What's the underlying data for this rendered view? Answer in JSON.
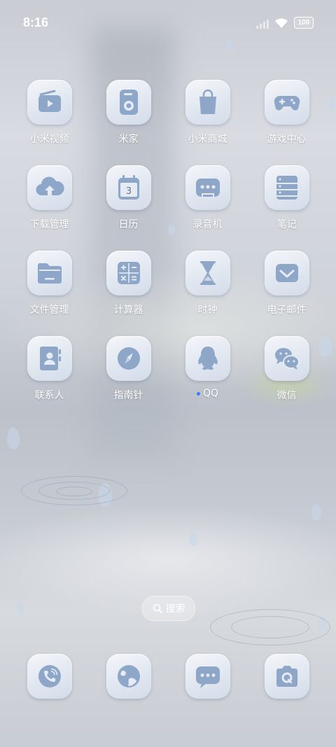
{
  "status_bar": {
    "time": "8:16",
    "battery": "100"
  },
  "apps": [
    [
      {
        "label": "小米视频",
        "icon": "video-icon"
      },
      {
        "label": "米家",
        "icon": "mijia-icon"
      },
      {
        "label": "小米商城",
        "icon": "shopping-bag-icon"
      },
      {
        "label": "游戏中心",
        "icon": "gamepad-icon"
      }
    ],
    [
      {
        "label": "下载管理",
        "icon": "cloud-download-icon"
      },
      {
        "label": "日历",
        "icon": "calendar-icon",
        "day": "3"
      },
      {
        "label": "录音机",
        "icon": "recorder-icon"
      },
      {
        "label": "笔记",
        "icon": "notes-icon"
      }
    ],
    [
      {
        "label": "文件管理",
        "icon": "folder-icon"
      },
      {
        "label": "计算器",
        "icon": "calculator-icon"
      },
      {
        "label": "时钟",
        "icon": "hourglass-icon"
      },
      {
        "label": "电子邮件",
        "icon": "email-icon"
      }
    ],
    [
      {
        "label": "联系人",
        "icon": "contacts-icon"
      },
      {
        "label": "指南针",
        "icon": "compass-icon"
      },
      {
        "label": "QQ",
        "icon": "qq-penguin-icon",
        "new_indicator": true
      },
      {
        "label": "微信",
        "icon": "wechat-icon"
      }
    ]
  ],
  "search": {
    "label": "搜索"
  },
  "dock": [
    {
      "name": "phone",
      "icon": "phone-icon"
    },
    {
      "name": "browser",
      "icon": "globe-icon"
    },
    {
      "name": "messages",
      "icon": "message-icon"
    },
    {
      "name": "camera",
      "icon": "camera-icon"
    }
  ],
  "colors": {
    "icon_glyph": "#8ea6c8",
    "icon_bg": "#e6ebf3",
    "new_dot": "#3f7df0"
  }
}
